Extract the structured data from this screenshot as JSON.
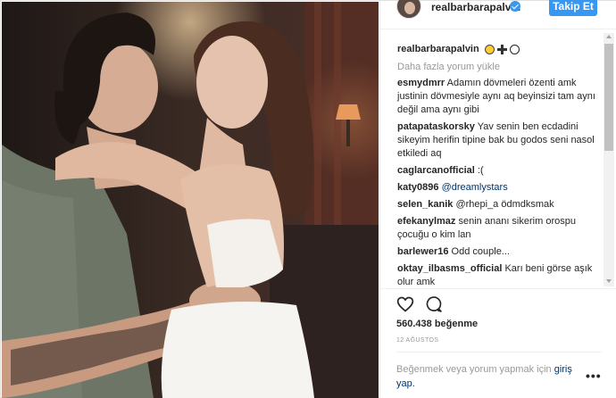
{
  "post": {
    "username": "realbarbarapalvin",
    "follow_label": "Takip Et",
    "caption_username": "realbarbarapalvin",
    "load_more": "Daha fazla yorum yükle",
    "comments": [
      {
        "user": "esmydmrr",
        "text": "Adamın dövmeleri özenti amk justinin dövmesiyle aynı aq beyinsizi tam aynı değil ama aynı gibi"
      },
      {
        "user": "patapataskorsky",
        "text": "Yav senin ben ecdadini sikeyim herifin tipine bak bu godos seni nasol etkiledi aq"
      },
      {
        "user": "caglarcanofficial",
        "text": ":("
      },
      {
        "user": "katy0896",
        "text": "@dreamlystars"
      },
      {
        "user": "selen_kanik",
        "text": "@rhepi_a ödmdksmak"
      },
      {
        "user": "efekanylmaz",
        "text": "senin ananı sikerim orospu çocuğu o kim lan"
      },
      {
        "user": "barlewer16",
        "text": "Odd couple..."
      },
      {
        "user": "oktay_ilbasms_official",
        "text": "Karı beni görse aşık olur amk"
      }
    ],
    "likes": "560.438 beğenme",
    "date": "12 AĞUSTOS",
    "login_prompt": "Beğenmek veya yorum yapmak için",
    "login_link": "giriş yap.",
    "more_options": "•••"
  },
  "icons": {
    "verified": "verified-badge-icon",
    "like": "heart-icon",
    "comment": "comment-bubble-icon",
    "more": "more-dots-icon"
  },
  "colors": {
    "accent": "#3897f0",
    "link": "#003569",
    "muted": "#999999",
    "text": "#262626"
  }
}
